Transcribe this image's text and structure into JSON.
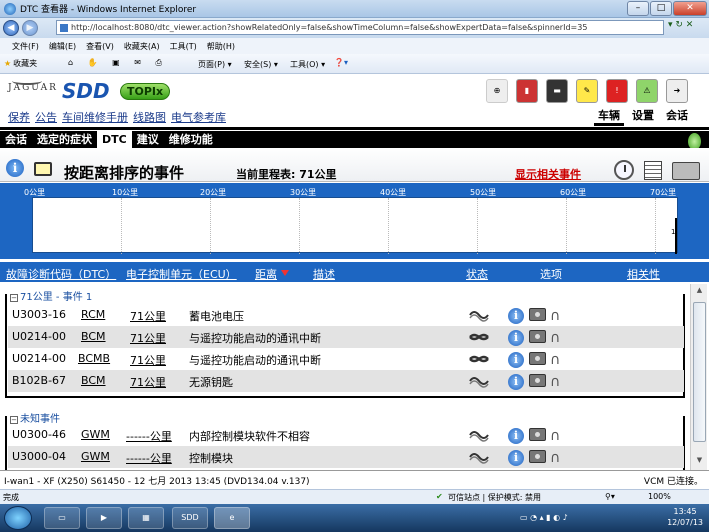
{
  "browser": {
    "title": "DTC 查看器 - Windows Internet Explorer",
    "url": "http://localhost:8080/dtc_viewer.action?showRelatedOnly=false&showTimeColumn=false&showExpertData=false&spinnerId=35",
    "menu": [
      "文件(F)",
      "编辑(E)",
      "查看(V)",
      "收藏夹(A)",
      "工具(T)",
      "帮助(H)"
    ],
    "favorites_label": "收藏夹",
    "toolbar": [
      "页面(P) ▾",
      "安全(S) ▾",
      "工具(O) ▾"
    ]
  },
  "app": {
    "brand_jaguar": "JAGUAR",
    "brand_sdd": "SDD",
    "brand_topix": "TOPIx",
    "top_links": [
      "保养",
      "公告",
      "车间维修手册",
      "线路图",
      "电气参考库"
    ],
    "right_tabs": [
      {
        "label": "车辆",
        "active": true
      },
      {
        "label": "设置",
        "active": false
      },
      {
        "label": "会话",
        "active": false
      }
    ],
    "sub_tabs": [
      {
        "label": "会话",
        "active": false
      },
      {
        "label": "选定的症状",
        "active": false
      },
      {
        "label": "DTC",
        "active": true
      },
      {
        "label": "建议",
        "active": false
      },
      {
        "label": "维修功能",
        "active": false
      }
    ]
  },
  "page": {
    "title": "按距离排序的事件",
    "odometer": "当前里程表: 71公里",
    "show_related": "显示相关事件"
  },
  "timeline": {
    "ticks": [
      "0公里",
      "10公里",
      "20公里",
      "30公里",
      "40公里",
      "50公里",
      "60公里",
      "70公里"
    ],
    "marker_label": "1",
    "marker_value_km": 71
  },
  "columns": [
    "故障诊断代码（DTC）",
    "电子控制单元（ECU）",
    "距离",
    "描述",
    "状态",
    "选项",
    "相关性"
  ],
  "groups": [
    {
      "header": "71公里 - 事件 1",
      "rows": [
        {
          "code": "U3003-16",
          "ecu": "RCM",
          "distance": "71公里",
          "desc": "蓄电池电压"
        },
        {
          "code": "U0214-00",
          "ecu": "BCM",
          "distance": "71公里",
          "desc": "与遥控功能启动的通讯中断"
        },
        {
          "code": "U0214-00",
          "ecu": "BCMB",
          "distance": "71公里",
          "desc": "与遥控功能启动的通讯中断"
        },
        {
          "code": "B102B-67",
          "ecu": "BCM",
          "distance": "71公里",
          "desc": "无源钥匙"
        }
      ]
    },
    {
      "header": "未知事件",
      "rows": [
        {
          "code": "U0300-46",
          "ecu": "GWM",
          "distance": "------公里",
          "desc": "内部控制模块软件不相容"
        },
        {
          "code": "U3000-04",
          "ecu": "GWM",
          "distance": "------公里",
          "desc": "控制模块"
        }
      ]
    }
  ],
  "status": {
    "vehicle": "I-wan1 - XF (X250) S61450 - 12 七月 2013 13:45 (DVD134.04 v.137)",
    "vcm": "VCM 已连接。"
  },
  "iestatus": {
    "done": "完成",
    "trusted": "可信站点 | 保护模式: 禁用",
    "zoom": "100%"
  },
  "taskbar": {
    "time": "13:45",
    "date": "12/07/13",
    "sdd_button": "SDD"
  }
}
